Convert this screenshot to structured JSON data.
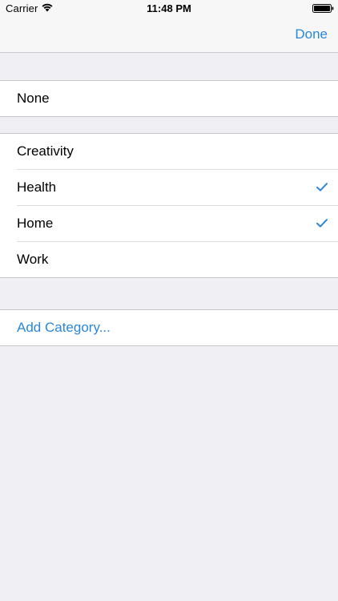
{
  "status_bar": {
    "carrier": "Carrier",
    "time": "11:48 PM",
    "wifi_icon": "wifi-icon",
    "battery_icon": "battery-icon"
  },
  "nav": {
    "done_label": "Done"
  },
  "sections": {
    "none": {
      "label": "None",
      "selected": false
    },
    "categories": [
      {
        "label": "Creativity",
        "selected": false
      },
      {
        "label": "Health",
        "selected": true
      },
      {
        "label": "Home",
        "selected": true
      },
      {
        "label": "Work",
        "selected": false
      }
    ],
    "add_category_label": "Add Category..."
  },
  "colors": {
    "tint": "#2a87d8",
    "background": "#efeff4",
    "nav_background": "#f7f7f7",
    "separator": "#c8c7cc"
  },
  "icons": {
    "checkmark": "checkmark-icon"
  }
}
